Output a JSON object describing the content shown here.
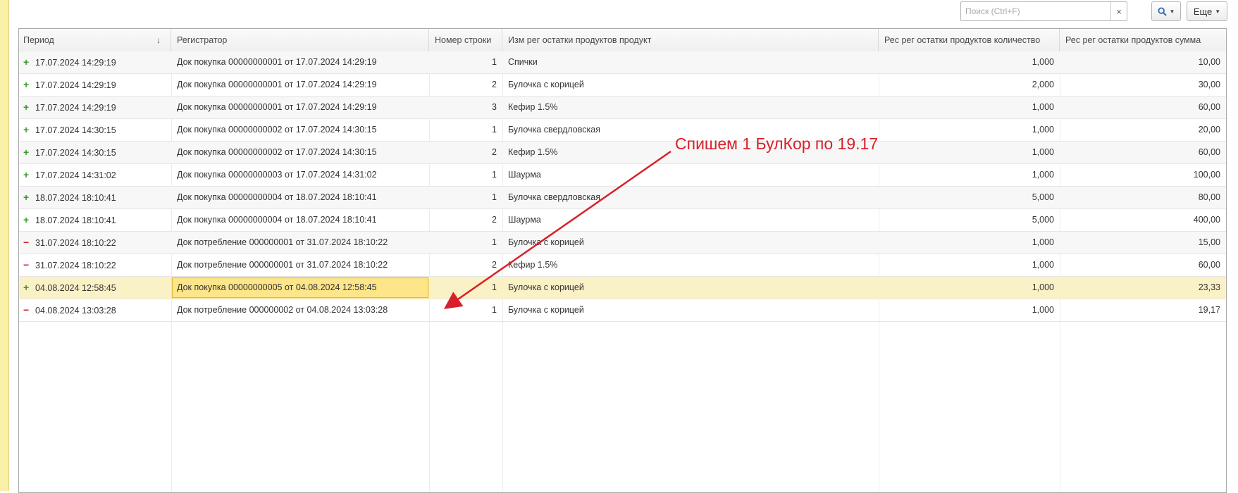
{
  "toolbar": {
    "search_placeholder": "Поиск (Ctrl+F)",
    "clear_label": "×",
    "find_icon": "search-icon",
    "more_label": "Еще"
  },
  "columns": {
    "period": "Период",
    "registrar": "Регистратор",
    "line_no": "Номер строки",
    "product": "Изм рег остатки продуктов продукт",
    "quantity": "Рес рег остатки продуктов количество",
    "sum": "Рес рег остатки продуктов сумма"
  },
  "rows": [
    {
      "sign": "+",
      "period": "17.07.2024 14:29:19",
      "registrar": "Док покупка 00000000001 от 17.07.2024 14:29:19",
      "line": "1",
      "product": "Спички",
      "qty": "1,000",
      "sum": "10,00"
    },
    {
      "sign": "+",
      "period": "17.07.2024 14:29:19",
      "registrar": "Док покупка 00000000001 от 17.07.2024 14:29:19",
      "line": "2",
      "product": "Булочка с корицей",
      "qty": "2,000",
      "sum": "30,00"
    },
    {
      "sign": "+",
      "period": "17.07.2024 14:29:19",
      "registrar": "Док покупка 00000000001 от 17.07.2024 14:29:19",
      "line": "3",
      "product": "Кефир 1.5%",
      "qty": "1,000",
      "sum": "60,00"
    },
    {
      "sign": "+",
      "period": "17.07.2024 14:30:15",
      "registrar": "Док покупка 00000000002 от 17.07.2024 14:30:15",
      "line": "1",
      "product": "Булочка свердловская",
      "qty": "1,000",
      "sum": "20,00"
    },
    {
      "sign": "+",
      "period": "17.07.2024 14:30:15",
      "registrar": "Док покупка 00000000002 от 17.07.2024 14:30:15",
      "line": "2",
      "product": "Кефир 1.5%",
      "qty": "1,000",
      "sum": "60,00"
    },
    {
      "sign": "+",
      "period": "17.07.2024 14:31:02",
      "registrar": "Док покупка 00000000003 от 17.07.2024 14:31:02",
      "line": "1",
      "product": "Шаурма",
      "qty": "1,000",
      "sum": "100,00"
    },
    {
      "sign": "+",
      "period": "18.07.2024 18:10:41",
      "registrar": "Док покупка 00000000004 от 18.07.2024 18:10:41",
      "line": "1",
      "product": "Булочка свердловская",
      "qty": "5,000",
      "sum": "80,00"
    },
    {
      "sign": "+",
      "period": "18.07.2024 18:10:41",
      "registrar": "Док покупка 00000000004 от 18.07.2024 18:10:41",
      "line": "2",
      "product": "Шаурма",
      "qty": "5,000",
      "sum": "400,00"
    },
    {
      "sign": "−",
      "period": "31.07.2024 18:10:22",
      "registrar": "Док потребление 000000001 от 31.07.2024 18:10:22",
      "line": "1",
      "product": "Булочка с корицей",
      "qty": "1,000",
      "sum": "15,00"
    },
    {
      "sign": "−",
      "period": "31.07.2024 18:10:22",
      "registrar": "Док потребление 000000001 от 31.07.2024 18:10:22",
      "line": "2",
      "product": "Кефир 1.5%",
      "qty": "1,000",
      "sum": "60,00"
    },
    {
      "sign": "+",
      "period": "04.08.2024 12:58:45",
      "registrar": "Док покупка 00000000005 от 04.08.2024 12:58:45",
      "line": "1",
      "product": "Булочка с корицей",
      "qty": "1,000",
      "sum": "23,33"
    },
    {
      "sign": "−",
      "period": "04.08.2024 13:03:28",
      "registrar": "Док потребление 000000002 от 04.08.2024 13:03:28",
      "line": "1",
      "product": "Булочка с корицей",
      "qty": "1,000",
      "sum": "19,17"
    }
  ],
  "selected_row": 10,
  "annotation": {
    "text": "Спишем 1 БулКор по 19.17",
    "color": "#d8202a"
  },
  "colors": {
    "plus": "#3a9a2a",
    "minus": "#d0202a",
    "selection": "#fbf1c6",
    "focus_cell": "#fde58a",
    "left_strip": "#fbf0a8"
  }
}
